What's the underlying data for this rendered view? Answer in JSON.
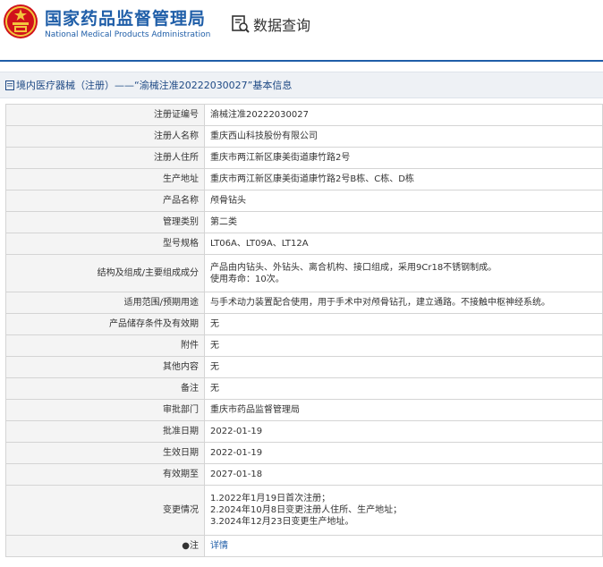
{
  "header": {
    "site_title": "国家药品监督管理局",
    "site_subtitle": "National Medical Products Administration",
    "query_label": "数据查询",
    "colors": {
      "brand": "#1f5ea8",
      "emblem_red": "#d0121b",
      "emblem_gold": "#f2c53d"
    },
    "icons": [
      "national-emblem-icon",
      "search-document-icon"
    ]
  },
  "breadcrumb": {
    "text": "境内医疗器械（注册）——“渝械注准20222030027”基本信息",
    "icon": "document-icon"
  },
  "rows": [
    {
      "label": "注册证编号",
      "value": "渝械注准20222030027"
    },
    {
      "label": "注册人名称",
      "value": "重庆西山科技股份有限公司"
    },
    {
      "label": "注册人住所",
      "value": "重庆市两江新区康美街道康竹路2号"
    },
    {
      "label": "生产地址",
      "value": "重庆市两江新区康美街道康竹路2号B栋、C栋、D栋"
    },
    {
      "label": "产品名称",
      "value": "颅骨钻头"
    },
    {
      "label": "管理类别",
      "value": "第二类"
    },
    {
      "label": "型号规格",
      "value": "LT06A、LT09A、LT12A"
    },
    {
      "label": "结构及组成/主要组成成分",
      "lines": [
        "产品由内钻头、外钻头、离合机构、接口组成，采用9Cr18不锈钢制成。",
        "使用寿命：10次。"
      ]
    },
    {
      "label": "适用范围/预期用途",
      "value": "与手术动力装置配合使用，用于手术中对颅骨钻孔，建立通路。不接触中枢神经系统。"
    },
    {
      "label": "产品储存条件及有效期",
      "value": "无"
    },
    {
      "label": "附件",
      "value": "无"
    },
    {
      "label": "其他内容",
      "value": "无"
    },
    {
      "label": "备注",
      "value": "无"
    },
    {
      "label": "审批部门",
      "value": "重庆市药品监督管理局"
    },
    {
      "label": "批准日期",
      "value": "2022-01-19"
    },
    {
      "label": "生效日期",
      "value": "2022-01-19"
    },
    {
      "label": "有效期至",
      "value": "2027-01-18"
    },
    {
      "label": "变更情况",
      "lines": [
        "1.2022年1月19日首次注册；",
        "2.2024年10月8日变更注册人住所、生产地址；",
        "3.2024年12月23日变更生产地址。"
      ]
    },
    {
      "label": "●注",
      "value": "详情",
      "link": true
    }
  ]
}
